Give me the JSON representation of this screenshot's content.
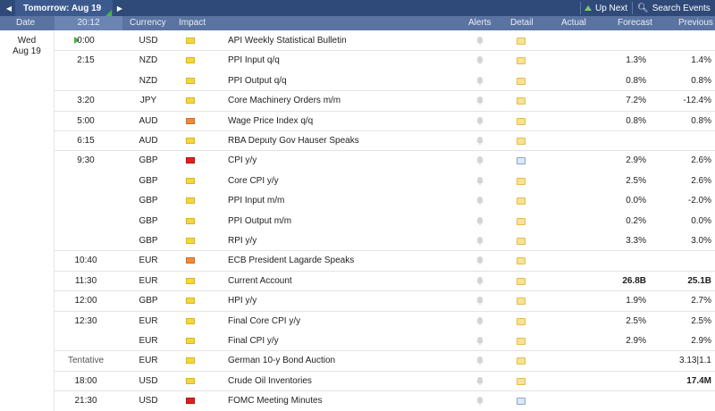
{
  "topbar": {
    "tomorrow_label": "Tomorrow: Aug 19",
    "up_next_label": "Up Next",
    "search_events_label": "Search Events"
  },
  "columns": {
    "date": "Date",
    "time": "20:12",
    "currency": "Currency",
    "impact": "Impact",
    "alerts": "Alerts",
    "detail": "Detail",
    "actual": "Actual",
    "forecast": "Forecast",
    "previous": "Previous"
  },
  "day": {
    "weekday": "Wed",
    "date": "Aug 19"
  },
  "colors": {
    "impact_high": "#e01f1f",
    "impact_medium": "#ef8a3c",
    "impact_low": "#f5d73b",
    "header_bg": "#5b73a0",
    "topbar_bg": "#2f4a79"
  },
  "icons": {
    "alert": "bell-icon",
    "detail": "folder-icon",
    "detail_media": "media-folder-icon",
    "next_event": "play-icon"
  },
  "rows": [
    {
      "time": "0:00",
      "currency": "USD",
      "impact": "yellow",
      "event": "API Weekly Statistical Bulletin",
      "forecast": "",
      "previous": "",
      "next": true
    },
    {
      "time": "2:15",
      "currency": "NZD",
      "impact": "yellow",
      "event": "PPI Input q/q",
      "forecast": "1.3%",
      "previous": "1.4%"
    },
    {
      "time": "",
      "currency": "NZD",
      "impact": "yellow",
      "event": "PPI Output q/q",
      "forecast": "0.8%",
      "previous": "0.8%"
    },
    {
      "time": "3:20",
      "currency": "JPY",
      "impact": "yellow",
      "event": "Core Machinery Orders m/m",
      "forecast": "7.2%",
      "previous": "-12.4%"
    },
    {
      "time": "5:00",
      "currency": "AUD",
      "impact": "orange",
      "event": "Wage Price Index q/q",
      "forecast": "0.8%",
      "previous": "0.8%"
    },
    {
      "time": "6:15",
      "currency": "AUD",
      "impact": "yellow",
      "event": "RBA Deputy Gov Hauser Speaks",
      "forecast": "",
      "previous": ""
    },
    {
      "time": "9:30",
      "currency": "GBP",
      "impact": "red",
      "event": "CPI y/y",
      "forecast": "2.9%",
      "previous": "2.6%",
      "media": true
    },
    {
      "time": "",
      "currency": "GBP",
      "impact": "yellow",
      "event": "Core CPI y/y",
      "forecast": "2.5%",
      "previous": "2.6%"
    },
    {
      "time": "",
      "currency": "GBP",
      "impact": "yellow",
      "event": "PPI Input m/m",
      "forecast": "0.0%",
      "previous": "-2.0%"
    },
    {
      "time": "",
      "currency": "GBP",
      "impact": "yellow",
      "event": "PPI Output m/m",
      "forecast": "0.2%",
      "previous": "0.0%"
    },
    {
      "time": "",
      "currency": "GBP",
      "impact": "yellow",
      "event": "RPI y/y",
      "forecast": "3.3%",
      "previous": "3.0%"
    },
    {
      "time": "10:40",
      "currency": "EUR",
      "impact": "orange",
      "event": "ECB President Lagarde Speaks",
      "forecast": "",
      "previous": ""
    },
    {
      "time": "11:30",
      "currency": "EUR",
      "impact": "yellow",
      "event": "Current Account",
      "forecast": "26.8B",
      "previous": "25.1B"
    },
    {
      "time": "12:00",
      "currency": "GBP",
      "impact": "yellow",
      "event": "HPI y/y",
      "forecast": "1.9%",
      "previous": "2.7%"
    },
    {
      "time": "12:30",
      "currency": "EUR",
      "impact": "yellow",
      "event": "Final Core CPI y/y",
      "forecast": "2.5%",
      "previous": "2.5%"
    },
    {
      "time": "",
      "currency": "EUR",
      "impact": "yellow",
      "event": "Final CPI y/y",
      "forecast": "2.9%",
      "previous": "2.9%"
    },
    {
      "time": "Tentative",
      "currency": "EUR",
      "impact": "yellow",
      "event": "German 10-y Bond Auction",
      "forecast": "",
      "previous": "3.13|1.1"
    },
    {
      "time": "18:00",
      "currency": "USD",
      "impact": "yellow",
      "event": "Crude Oil Inventories",
      "forecast": "",
      "previous": "17.4M"
    },
    {
      "time": "21:30",
      "currency": "USD",
      "impact": "red",
      "event": "FOMC Meeting Minutes",
      "forecast": "",
      "previous": "",
      "media": true
    }
  ]
}
